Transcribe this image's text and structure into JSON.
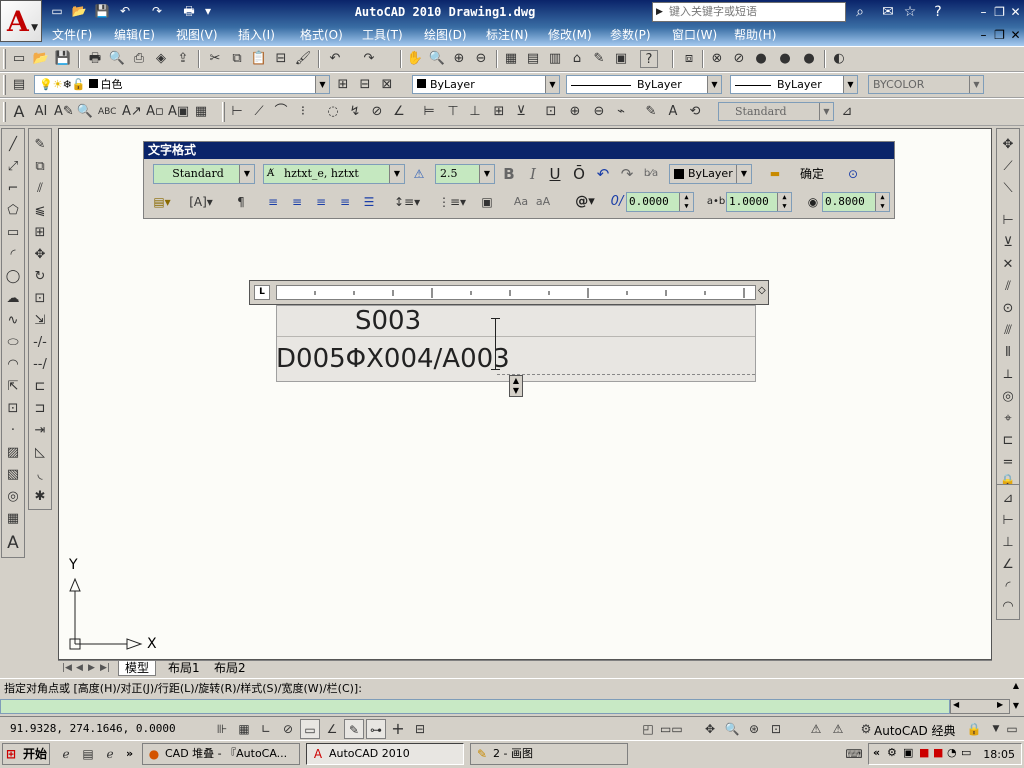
{
  "app": {
    "title": "AutoCAD 2010  Drawing1.dwg",
    "search_placeholder": "键入关键字或短语",
    "logo_letter": "A"
  },
  "menus": [
    "文件(F)",
    "编辑(E)",
    "视图(V)",
    "插入(I)",
    "格式(O)",
    "工具(T)",
    "绘图(D)",
    "标注(N)",
    "修改(M)",
    "参数(P)",
    "窗口(W)",
    "帮助(H)"
  ],
  "layers_toolbar": {
    "layer_name": "白色",
    "color": "ByLayer",
    "linetype": "ByLayer",
    "lineweight": "ByLayer",
    "plotstyle": "BYCOLOR"
  },
  "styles_toolbar": {
    "dim_style": "Standard"
  },
  "text_format": {
    "title": "文字格式",
    "style": "Standard",
    "font": "hztxt_e, hztxt",
    "height": "2.5",
    "bold": "B",
    "italic": "I",
    "underline": "U",
    "overline": "Ō",
    "color": "ByLayer",
    "ok_label": "确定",
    "oblique": "0.0000",
    "tracking": "1.0000",
    "width_factor": "0.8000",
    "font_tags": [
      "Aa",
      "aA"
    ]
  },
  "ruler": {
    "left_label": "L"
  },
  "editor": {
    "line1": "S003",
    "line2": "D005ΦX004/A003"
  },
  "ucs": {
    "x_label": "X",
    "y_label": "Y"
  },
  "tabs": [
    "模型",
    "布局1",
    "布局2"
  ],
  "command": {
    "prompt": "指定对角点或 [高度(H)/对正(J)/行距(L)/旋转(R)/样式(S)/宽度(W)/栏(C)]:"
  },
  "status": {
    "coords": "91.9328, 274.1646, 0.0000",
    "workspace": "AutoCAD 经典"
  },
  "taskbar": {
    "start": "开始",
    "tasks": [
      "CAD 堆叠 - 『AutoCA...",
      "AutoCAD 2010",
      "2 - 画图"
    ],
    "clock": "18:05"
  }
}
